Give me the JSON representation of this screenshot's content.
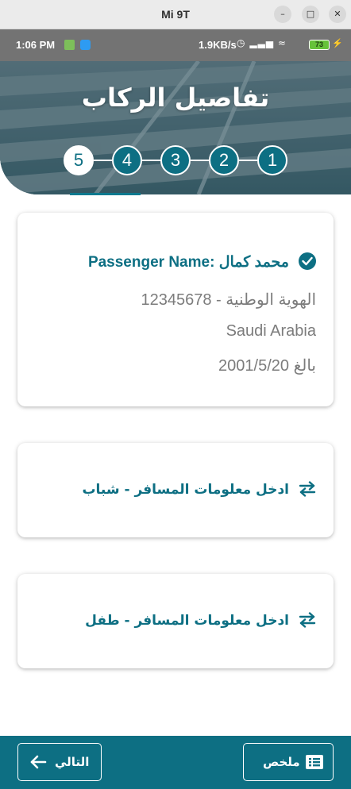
{
  "window": {
    "title": "Mi 9T"
  },
  "status_bar": {
    "time": "1:06 PM",
    "net_speed": "1.9KB/s",
    "battery": "73"
  },
  "header": {
    "title": "تفاصيل الركاب",
    "steps": [
      "5",
      "4",
      "3",
      "2",
      "1"
    ],
    "active_step": "5"
  },
  "passengers": {
    "completed": {
      "name_label": "Passenger Name:",
      "name_value": "محمد كمال",
      "id_line": "الهوية الوطنية - 12345678",
      "country": "Saudi Arabia",
      "age_line": "بالغ 2001/5/20"
    },
    "pending": [
      {
        "label": "ادخل معلومات المسافر - شباب"
      },
      {
        "label": "ادخل معلومات المسافر - طفل"
      }
    ]
  },
  "footer": {
    "next_label": "التالي",
    "summary_label": "ملخص"
  },
  "colors": {
    "accent": "#0d6f83",
    "status_bar": "#737373",
    "muted_text": "#7c7c7c"
  },
  "icons": {
    "window": [
      "minimize-icon",
      "maximize-icon",
      "close-icon"
    ],
    "passenger": "check-circle-icon",
    "pending": "swap-icon",
    "next": "arrow-left-icon",
    "summary": "list-icon"
  }
}
